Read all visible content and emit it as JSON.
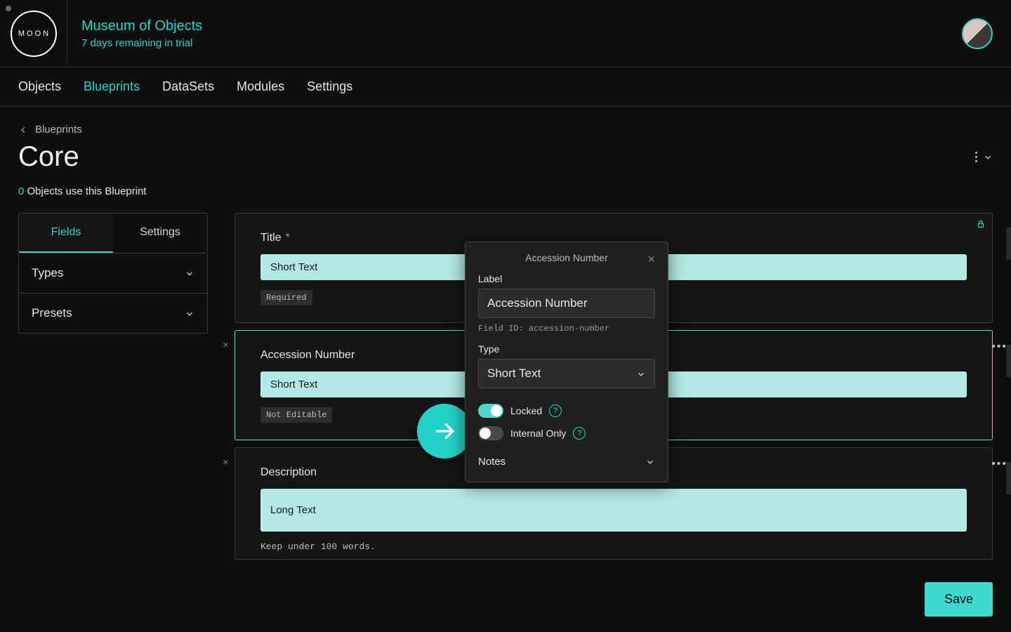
{
  "logo_text": "MOON",
  "org": {
    "name": "Museum of Objects",
    "trial": "7 days remaining in trial"
  },
  "nav": [
    "Objects",
    "Blueprints",
    "DataSets",
    "Modules",
    "Settings"
  ],
  "nav_active_index": 1,
  "breadcrumb": {
    "back_label": "Blueprints"
  },
  "page_title": "Core",
  "usage": {
    "count": "0",
    "text": "Objects use this Blueprint"
  },
  "tabs": {
    "fields": "Fields",
    "settings": "Settings"
  },
  "sidebar": {
    "types": "Types",
    "presets": "Presets"
  },
  "cards": [
    {
      "title": "Title",
      "required": true,
      "type": "Short Text",
      "badge": "Required",
      "locked": true
    },
    {
      "title": "Accession Number",
      "required": false,
      "type": "Short Text",
      "badge": "Not Editable",
      "selected": true
    },
    {
      "title": "Description",
      "required": false,
      "type": "Long Text",
      "note": "Keep under 100 words."
    }
  ],
  "popover": {
    "header": "Accession Number",
    "label_lbl": "Label",
    "label_value": "Accession Number",
    "field_id": "Field ID: accession-number",
    "type_lbl": "Type",
    "type_value": "Short Text",
    "locked_lbl": "Locked",
    "internal_lbl": "Internal Only",
    "notes_lbl": "Notes"
  },
  "save_label": "Save"
}
